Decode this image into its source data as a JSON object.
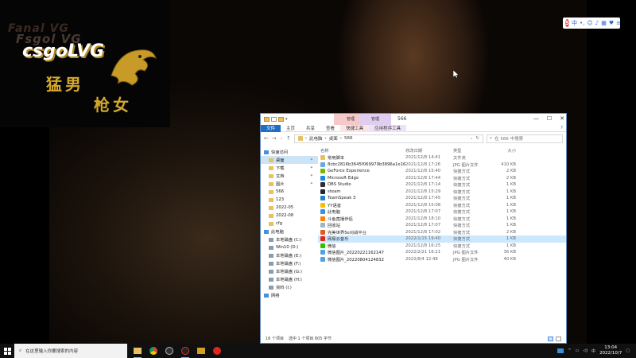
{
  "overlay": {
    "logo_shadow_1": "Fanal VG",
    "logo_shadow_2": "Fsgol VG",
    "logo_main": "csgoLVG",
    "logo_sub_1": "猛男",
    "logo_sub_2": "枪女"
  },
  "ime": {
    "s_badge": "S",
    "mode": "中"
  },
  "explorer": {
    "window_title": "566",
    "context_tab_1": {
      "header": "管理",
      "label": "快捷工具"
    },
    "context_tab_2": {
      "header": "管理",
      "label": "应用程序工具"
    },
    "ribbon_tabs": [
      "文件",
      "主页",
      "共享",
      "查看",
      "快捷工具",
      "应用程序工具"
    ],
    "address_path": [
      "此电脑",
      "桌面",
      "566"
    ],
    "search_placeholder": "在 566 中搜索",
    "nav_items": [
      {
        "label": "快速访问",
        "group": true
      },
      {
        "label": "桌面",
        "pinned": true,
        "selected": true
      },
      {
        "label": "下载",
        "pinned": true
      },
      {
        "label": "文档",
        "pinned": true
      },
      {
        "label": "图片",
        "pinned": true
      },
      {
        "label": "566"
      },
      {
        "label": "123"
      },
      {
        "label": "2022-05"
      },
      {
        "label": "2022-08"
      },
      {
        "label": "cfg"
      },
      {
        "label": "此电脑",
        "group": true
      },
      {
        "label": "本地磁盘 (C:)"
      },
      {
        "label": "Win10 (D:)"
      },
      {
        "label": "本地磁盘 (E:)"
      },
      {
        "label": "本地磁盘 (F:)"
      },
      {
        "label": "本地磁盘 (G:)"
      },
      {
        "label": "本地磁盘 (H:)"
      },
      {
        "label": "资料 (I:)"
      },
      {
        "label": "网络",
        "group": true
      }
    ],
    "columns": {
      "name": "名称",
      "date": "修改日期",
      "type": "类型",
      "size": "大小"
    },
    "files": [
      {
        "name": "常用脚本",
        "date": "2021/12/8 14:41",
        "type": "文件夹",
        "size": "",
        "icon": "folder"
      },
      {
        "name": "8cbc2816b3645f069979b3896a1e16e",
        "date": "2021/12/8 17:26",
        "type": "JPG 图片文件",
        "size": "410 KB",
        "icon": "image"
      },
      {
        "name": "GeForce Experience",
        "date": "2021/12/8 15:40",
        "type": "快捷方式",
        "size": "2 KB",
        "icon": "geforce"
      },
      {
        "name": "Microsoft Edge",
        "date": "2021/12/8 17:44",
        "type": "快捷方式",
        "size": "2 KB",
        "icon": "edge"
      },
      {
        "name": "OBS Studio",
        "date": "2021/12/8 17:14",
        "type": "快捷方式",
        "size": "1 KB",
        "icon": "obs"
      },
      {
        "name": "steam",
        "date": "2021/12/8 15:29",
        "type": "快捷方式",
        "size": "1 KB",
        "icon": "steam"
      },
      {
        "name": "TeamSpeak 3",
        "date": "2021/12/8 17:45",
        "type": "快捷方式",
        "size": "1 KB",
        "icon": "teamspeak"
      },
      {
        "name": "YY语音",
        "date": "2021/12/8 15:08",
        "type": "快捷方式",
        "size": "1 KB",
        "icon": "yy"
      },
      {
        "name": "此电脑",
        "date": "2021/12/8 17:07",
        "type": "快捷方式",
        "size": "1 KB",
        "icon": "pc"
      },
      {
        "name": "斗鱼直播伴侣",
        "date": "2021/12/8 18:10",
        "type": "快捷方式",
        "size": "1 KB",
        "icon": "douyu"
      },
      {
        "name": "回收站",
        "date": "2021/12/8 17:07",
        "type": "快捷方式",
        "size": "1 KB",
        "icon": "recycle"
      },
      {
        "name": "完美世界5e对战平台",
        "date": "2021/12/8 17:02",
        "type": "快捷方式",
        "size": "2 KB",
        "icon": "perfect"
      },
      {
        "name": "网易云音乐",
        "date": "2022/1/15 19:40",
        "type": "快捷方式",
        "size": "1 KB",
        "icon": "netease",
        "selected": true
      },
      {
        "name": "微信",
        "date": "2021/12/8 16:25",
        "type": "快捷方式",
        "size": "1 KB",
        "icon": "wechat"
      },
      {
        "name": "微信图片_20220221162147",
        "date": "2022/2/21 16:21",
        "type": "JPG 图片文件",
        "size": "36 KB",
        "icon": "wechat-img"
      },
      {
        "name": "微信图片_20220804124832",
        "date": "2022/8/4 12:48",
        "type": "JPG 图片文件",
        "size": "40 KB",
        "icon": "wechat-img"
      }
    ],
    "status_count": "16 个项目",
    "status_selected": "选中 1 个项目  805 字节"
  },
  "taskbar": {
    "search_placeholder": "在这里输入你要搜索的内容",
    "time": "13:04",
    "date": "2022/10/7"
  },
  "colors": {
    "accent": "#1e6fc4",
    "selection": "#cce8ff",
    "logo_gold": "#d4a82a"
  }
}
